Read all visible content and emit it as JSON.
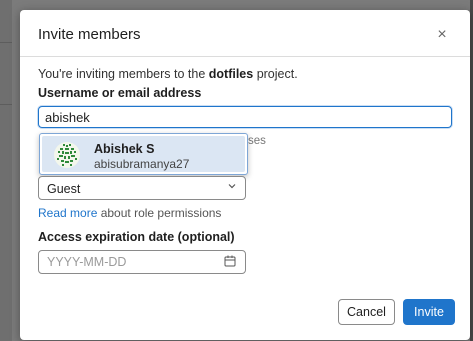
{
  "modal": {
    "title": "Invite members",
    "close_glyph": "×",
    "intro_prefix": "You're inviting members to the ",
    "project_name": "dotfiles",
    "intro_suffix": " project."
  },
  "username_field": {
    "label": "Username or email address",
    "value": "abishek",
    "hint_fragment": "ses"
  },
  "suggestion": {
    "name": "Abishek S",
    "username": "abisubramanya27"
  },
  "role": {
    "selected": "Guest",
    "link_text": "Read more",
    "link_suffix": " about role permissions"
  },
  "expiration": {
    "label": "Access expiration date (optional)",
    "placeholder": "YYYY-MM-DD"
  },
  "buttons": {
    "cancel": "Cancel",
    "invite": "Invite"
  },
  "colors": {
    "accent": "#1f75cb",
    "suggestion_highlight": "#dbe6f3",
    "avatar_pattern": "#2f8a3a"
  },
  "icons": {
    "close": "close-icon",
    "chevron": "chevron-down-icon",
    "calendar": "calendar-icon",
    "avatar": "identicon-avatar"
  }
}
